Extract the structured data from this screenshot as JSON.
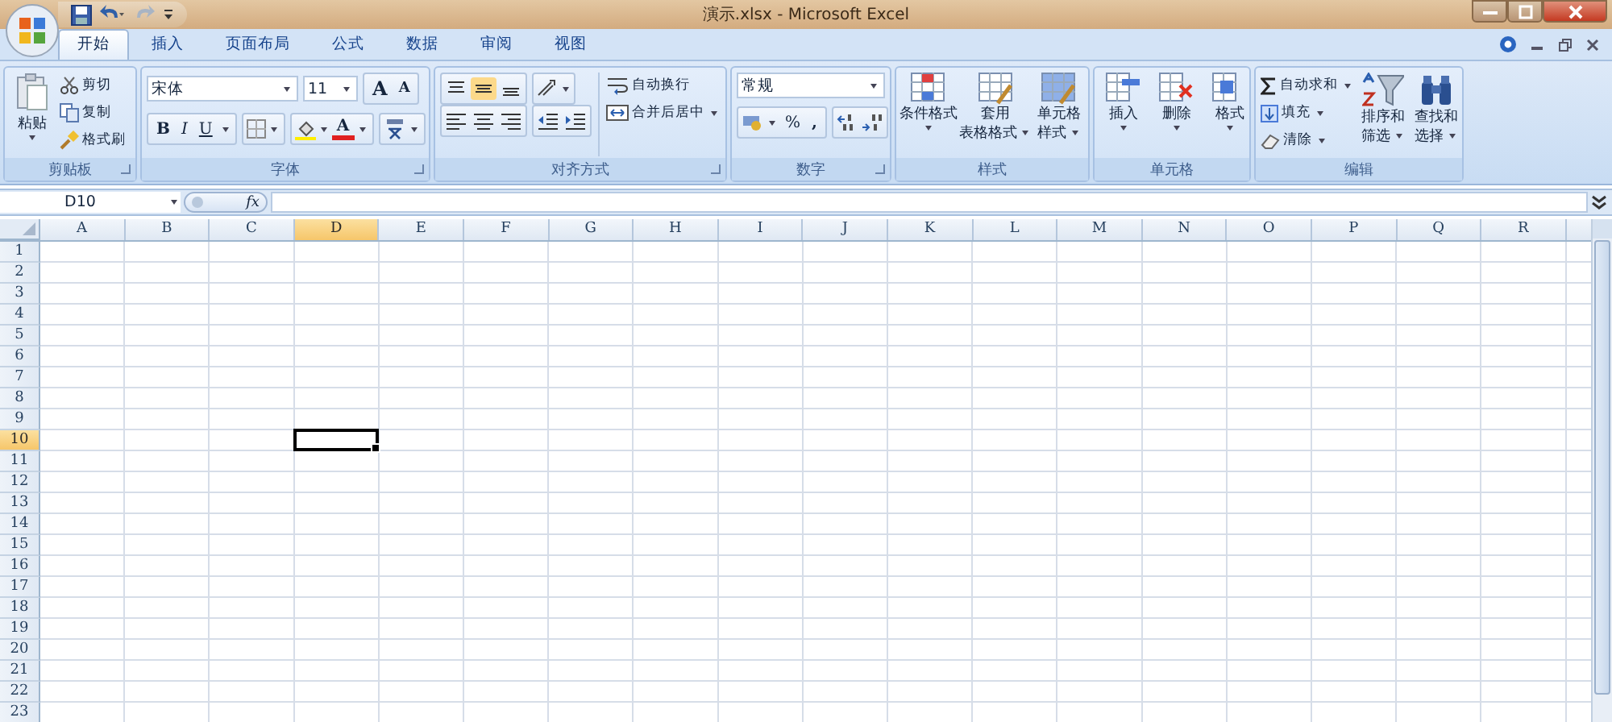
{
  "window": {
    "title": "演示.xlsx - Microsoft Excel"
  },
  "tabs": [
    {
      "label": "开始",
      "selected": true
    },
    {
      "label": "插入",
      "selected": false
    },
    {
      "label": "页面布局",
      "selected": false
    },
    {
      "label": "公式",
      "selected": false
    },
    {
      "label": "数据",
      "selected": false
    },
    {
      "label": "审阅",
      "selected": false
    },
    {
      "label": "视图",
      "selected": false
    }
  ],
  "clipboard": {
    "label": "剪贴板",
    "paste": "粘贴",
    "items": [
      "剪切",
      "复制",
      "格式刷"
    ]
  },
  "font": {
    "label": "字体",
    "font_name": "宋体",
    "font_size": "11",
    "size_buttons": [
      "A",
      "A"
    ],
    "style_buttons": [
      "B",
      "I",
      "U"
    ],
    "color_button": "A"
  },
  "alignment": {
    "label": "对齐方式",
    "wrap": "自动换行",
    "merge": "合并后居中"
  },
  "number": {
    "label": "数字",
    "format": "常规",
    "buttons": [
      "%",
      ","
    ]
  },
  "styles": {
    "label": "样式",
    "items": [
      [
        "条件格式"
      ],
      [
        "套用",
        "表格格式"
      ],
      [
        "单元格",
        "样式"
      ]
    ]
  },
  "cells": {
    "label": "单元格",
    "items": [
      "插入",
      "删除",
      "格式"
    ]
  },
  "editing": {
    "label": "编辑",
    "items": [
      "自动求和",
      "填充",
      "清除"
    ],
    "big": [
      [
        "排序和",
        "筛选"
      ],
      [
        "查找和",
        "选择"
      ]
    ]
  },
  "formula_bar": {
    "name_box": "D10",
    "fx": "fx"
  },
  "sheet": {
    "columns": [
      {
        "label": "A",
        "selected": false
      },
      {
        "label": "B",
        "selected": false
      },
      {
        "label": "C",
        "selected": false
      },
      {
        "label": "D",
        "selected": true
      },
      {
        "label": "E",
        "selected": false
      },
      {
        "label": "F",
        "selected": false
      },
      {
        "label": "G",
        "selected": false
      },
      {
        "label": "H",
        "selected": false
      },
      {
        "label": "I",
        "selected": false
      },
      {
        "label": "J",
        "selected": false
      },
      {
        "label": "K",
        "selected": false
      },
      {
        "label": "L",
        "selected": false
      },
      {
        "label": "M",
        "selected": false
      },
      {
        "label": "N",
        "selected": false
      },
      {
        "label": "O",
        "selected": false
      },
      {
        "label": "P",
        "selected": false
      },
      {
        "label": "Q",
        "selected": false
      },
      {
        "label": "R",
        "selected": false
      }
    ],
    "rows": [
      {
        "label": "1",
        "selected": false
      },
      {
        "label": "2",
        "selected": false
      },
      {
        "label": "3",
        "selected": false
      },
      {
        "label": "4",
        "selected": false
      },
      {
        "label": "5",
        "selected": false
      },
      {
        "label": "6",
        "selected": false
      },
      {
        "label": "7",
        "selected": false
      },
      {
        "label": "8",
        "selected": false
      },
      {
        "label": "9",
        "selected": false
      },
      {
        "label": "10",
        "selected": true
      },
      {
        "label": "11",
        "selected": false
      },
      {
        "label": "12",
        "selected": false
      },
      {
        "label": "13",
        "selected": false
      },
      {
        "label": "14",
        "selected": false
      },
      {
        "label": "15",
        "selected": false
      },
      {
        "label": "16",
        "selected": false
      },
      {
        "label": "17",
        "selected": false
      },
      {
        "label": "18",
        "selected": false
      },
      {
        "label": "19",
        "selected": false
      },
      {
        "label": "20",
        "selected": false
      },
      {
        "label": "21",
        "selected": false
      },
      {
        "label": "22",
        "selected": false
      },
      {
        "label": "23",
        "selected": false
      }
    ]
  }
}
